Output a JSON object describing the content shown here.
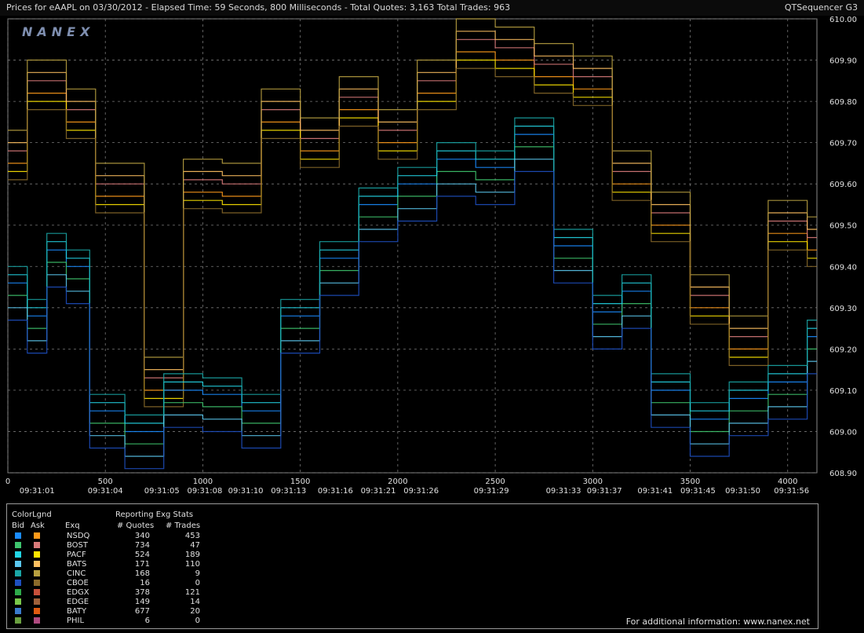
{
  "header": {
    "title": "Prices for  eAAPL  on  03/30/2012  -  Elapsed Time: 59 Seconds, 800 Milliseconds  -  Total Quotes: 3,163  Total Trades: 963",
    "app_name": "QTSequencer G3"
  },
  "logo_text": "NANEX",
  "chart_data": {
    "type": "line",
    "y_min": 608.9,
    "y_max": 610.0,
    "y_ticks": [
      "610.00",
      "609.90",
      "609.80",
      "609.70",
      "609.60",
      "609.50",
      "609.40",
      "609.30",
      "609.20",
      "609.10",
      "609.00",
      "608.90"
    ],
    "x_min": 0,
    "x_max": 4150,
    "x_ticks": [
      {
        "v": 0,
        "label": "0"
      },
      {
        "v": 500,
        "label": "500"
      },
      {
        "v": 1000,
        "label": "1000"
      },
      {
        "v": 1500,
        "label": "1500"
      },
      {
        "v": 2000,
        "label": "2000"
      },
      {
        "v": 2500,
        "label": "2500"
      },
      {
        "v": 3000,
        "label": "3000"
      },
      {
        "v": 3500,
        "label": "3500"
      },
      {
        "v": 4000,
        "label": "4000"
      }
    ],
    "time_ticks": [
      {
        "v": 150,
        "label": "09:31:01"
      },
      {
        "v": 500,
        "label": "09:31:04"
      },
      {
        "v": 790,
        "label": "09:31:05"
      },
      {
        "v": 1010,
        "label": "09:31:08"
      },
      {
        "v": 1220,
        "label": "09:31:10"
      },
      {
        "v": 1440,
        "label": "09:31:13"
      },
      {
        "v": 1680,
        "label": "09:31:16"
      },
      {
        "v": 1900,
        "label": "09:31:21"
      },
      {
        "v": 2120,
        "label": "09:31:26"
      },
      {
        "v": 2480,
        "label": "09:31:29"
      },
      {
        "v": 2850,
        "label": "09:31:33"
      },
      {
        "v": 3060,
        "label": "09:31:37"
      },
      {
        "v": 3320,
        "label": "09:31:41"
      },
      {
        "v": 3540,
        "label": "09:31:45"
      },
      {
        "v": 3770,
        "label": "09:31:50"
      },
      {
        "v": 4020,
        "label": "09:31:56"
      }
    ],
    "grid": true,
    "bid_envelope": [
      {
        "x": 0,
        "y": 609.36
      },
      {
        "x": 100,
        "y": 609.28
      },
      {
        "x": 200,
        "y": 609.44
      },
      {
        "x": 300,
        "y": 609.4
      },
      {
        "x": 420,
        "y": 609.05
      },
      {
        "x": 600,
        "y": 609.0
      },
      {
        "x": 800,
        "y": 609.1
      },
      {
        "x": 1000,
        "y": 609.09
      },
      {
        "x": 1200,
        "y": 609.05
      },
      {
        "x": 1400,
        "y": 609.28
      },
      {
        "x": 1600,
        "y": 609.42
      },
      {
        "x": 1800,
        "y": 609.55
      },
      {
        "x": 2000,
        "y": 609.6
      },
      {
        "x": 2200,
        "y": 609.66
      },
      {
        "x": 2400,
        "y": 609.64
      },
      {
        "x": 2600,
        "y": 609.72
      },
      {
        "x": 2800,
        "y": 609.45
      },
      {
        "x": 3000,
        "y": 609.29
      },
      {
        "x": 3150,
        "y": 609.34
      },
      {
        "x": 3300,
        "y": 609.1
      },
      {
        "x": 3500,
        "y": 609.03
      },
      {
        "x": 3700,
        "y": 609.08
      },
      {
        "x": 3900,
        "y": 609.12
      },
      {
        "x": 4100,
        "y": 609.23
      }
    ],
    "ask_envelope": [
      {
        "x": 0,
        "y": 609.65
      },
      {
        "x": 100,
        "y": 609.82
      },
      {
        "x": 300,
        "y": 609.75
      },
      {
        "x": 450,
        "y": 609.57
      },
      {
        "x": 700,
        "y": 609.1
      },
      {
        "x": 900,
        "y": 609.58
      },
      {
        "x": 1100,
        "y": 609.57
      },
      {
        "x": 1300,
        "y": 609.75
      },
      {
        "x": 1500,
        "y": 609.68
      },
      {
        "x": 1700,
        "y": 609.78
      },
      {
        "x": 1900,
        "y": 609.7
      },
      {
        "x": 2100,
        "y": 609.82
      },
      {
        "x": 2300,
        "y": 609.92
      },
      {
        "x": 2500,
        "y": 609.9
      },
      {
        "x": 2700,
        "y": 609.86
      },
      {
        "x": 2900,
        "y": 609.83
      },
      {
        "x": 3100,
        "y": 609.6
      },
      {
        "x": 3300,
        "y": 609.5
      },
      {
        "x": 3500,
        "y": 609.3
      },
      {
        "x": 3700,
        "y": 609.2
      },
      {
        "x": 3900,
        "y": 609.48
      },
      {
        "x": 4100,
        "y": 609.44
      }
    ]
  },
  "legend": {
    "color_title": "ColorLgnd",
    "stats_title": "Reporting Exg Stats",
    "col_bid": "Bid",
    "col_ask": "Ask",
    "col_exq": "Exq",
    "col_quotes": "# Quotes",
    "col_trades": "# Trades",
    "rows": [
      {
        "exq": "NSDQ",
        "quotes": "340",
        "trades": "453",
        "bid_color": "#1a8cff",
        "ask_color": "#ff9a1a"
      },
      {
        "exq": "BOST",
        "quotes": "734",
        "trades": "47",
        "bid_color": "#3ec46d",
        "ask_color": "#d97a7a"
      },
      {
        "exq": "PACF",
        "quotes": "524",
        "trades": "189",
        "bid_color": "#22d6e6",
        "ask_color": "#ffe600"
      },
      {
        "exq": "BATS",
        "quotes": "171",
        "trades": "110",
        "bid_color": "#5bc8f0",
        "ask_color": "#ffc060"
      },
      {
        "exq": "CINC",
        "quotes": "168",
        "trades": "9",
        "bid_color": "#1aa6a6",
        "ask_color": "#b8a040"
      },
      {
        "exq": "CBOE",
        "quotes": "16",
        "trades": "0",
        "bid_color": "#1e4fc0",
        "ask_color": "#8a6a2a"
      },
      {
        "exq": "EDGX",
        "quotes": "378",
        "trades": "121",
        "bid_color": "#2eaa4a",
        "ask_color": "#c8503a"
      },
      {
        "exq": "EDGE",
        "quotes": "149",
        "trades": "14",
        "bid_color": "#7ac84a",
        "ask_color": "#a0603a"
      },
      {
        "exq": "BATY",
        "quotes": "677",
        "trades": "20",
        "bid_color": "#3a7acc",
        "ask_color": "#e05a10"
      },
      {
        "exq": "PHIL",
        "quotes": "6",
        "trades": "0",
        "bid_color": "#6aa040",
        "ask_color": "#b04a80"
      }
    ]
  },
  "footer": "For additional information: www.nanex.net"
}
